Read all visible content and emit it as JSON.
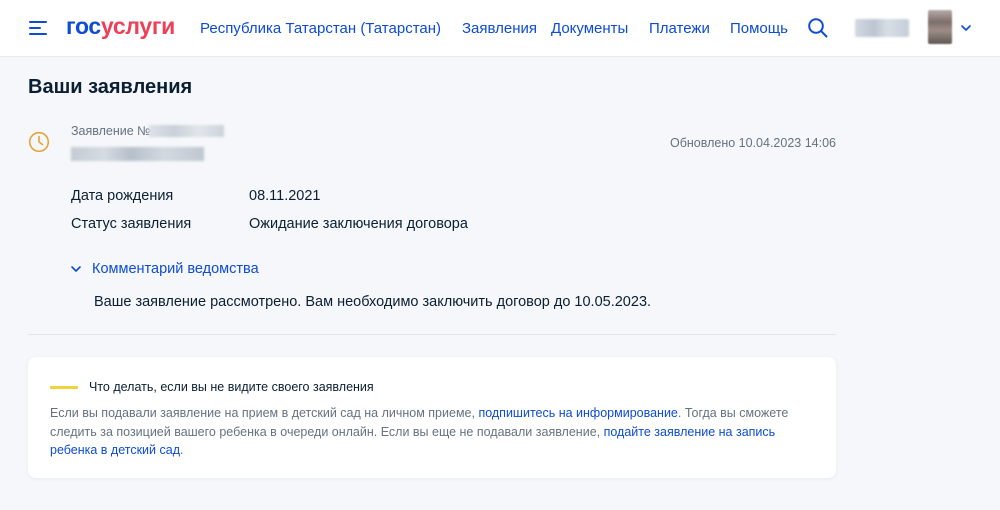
{
  "header": {
    "logo_part1": "гос",
    "logo_part2": "услуги",
    "region": "Республика Татарстан (Татарстан)",
    "nav": [
      {
        "label": "Заявления"
      },
      {
        "label": "Документы"
      },
      {
        "label": "Платежи"
      },
      {
        "label": "Помощь"
      }
    ],
    "icons": {
      "menu": "menu-icon",
      "search": "search-icon",
      "account_menu": "chevron-down-icon"
    }
  },
  "page": {
    "title": "Ваши заявления"
  },
  "application": {
    "status_icon": "clock-icon",
    "label": "Заявление №",
    "updated": "Обновлено 10.04.2023 14:06",
    "details": [
      {
        "label": "Дата рождения",
        "value": "08.11.2021"
      },
      {
        "label": "Статус заявления",
        "value": "Ожидание заключения договора"
      }
    ],
    "comment": {
      "toggle_label": "Комментарий ведомства",
      "text": "Ваше заявление рассмотрено. Вам необходимо заключить договор до 10.05.2023."
    }
  },
  "info": {
    "accent_color": "#f2d23a",
    "title": "Что делать, если вы не видите своего заявления",
    "text1": "Если вы подавали заявление на прием в детский сад на личном приеме, ",
    "link1": "подпишитесь на информирование",
    "text2": ". Тогда вы сможете следить за позицией вашего ребенка в очереди онлайн. Если вы еще не подавали заявление, ",
    "link2": "подайте заявление на запись ребенка в детский сад",
    "text3": "."
  },
  "colors": {
    "brand_blue": "#0d4cd3",
    "brand_red": "#ee3f58",
    "status_orange": "#e8a23a"
  }
}
